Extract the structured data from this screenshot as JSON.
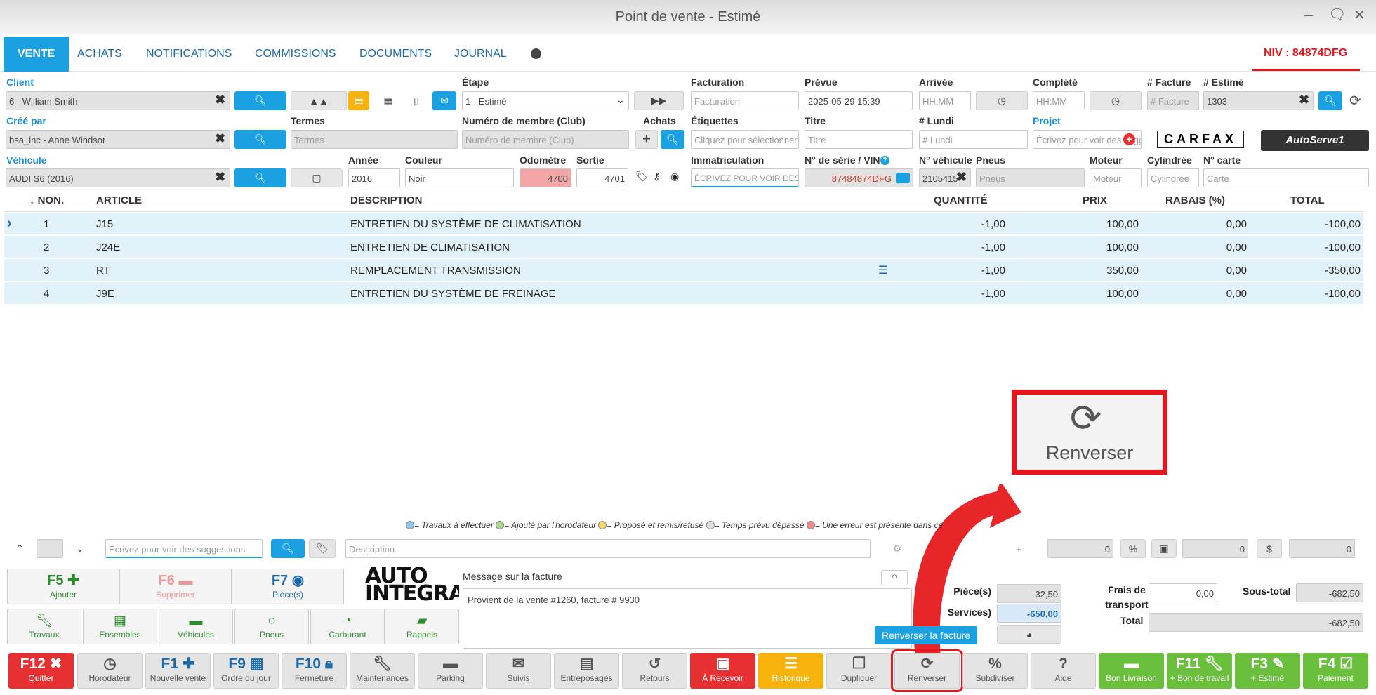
{
  "window": {
    "title": "Point de vente - Estimé",
    "min": "–",
    "chat": "🗨",
    "close": "✕"
  },
  "tabs": [
    "VENTE",
    "ACHATS",
    "NOTIFICATIONS",
    "COMMISSIONS",
    "DOCUMENTS",
    "JOURNAL"
  ],
  "niv": "NIV : 84874DFG",
  "form": {
    "client_label": "Client",
    "client_value": "6 - William Smith",
    "etape_label": "Étape",
    "etape_value": "1 - Estimé",
    "facturation_label": "Facturation",
    "facturation_ph": "Facturation",
    "prevue_label": "Prévue",
    "prevue_value": "2025-05-29 15:39",
    "arrivee_label": "Arrivée",
    "arrivee_ph": "HH:MM",
    "complete_label": "Complété",
    "complete_ph": "HH:MM",
    "nfacture_label": "# Facture",
    "nfacture_ph": "# Facture",
    "nestime_label": "# Estimé",
    "nestime_value": "1303",
    "cree_label": "Créé par",
    "cree_value": "bsa_inc - Anne Windsor",
    "termes_label": "Termes",
    "termes_ph": "Termes",
    "membre_label": "Numéro de membre (Club)",
    "membre_ph": "Numéro de membre (Club)",
    "achats_label": "Achats",
    "etiquettes_label": "Étiquettes",
    "etiquettes_ph": "Cliquez pour sélectionner",
    "titre_label": "Titre",
    "titre_ph": "Titre",
    "lundi_label": "# Lundi",
    "lundi_ph": "# Lundi",
    "projet_label": "Projet",
    "projet_ph": "Écrivez pour voir des suggestions",
    "carfax": "CARFAX",
    "autoserve": "AutoServe1",
    "vehicule_label": "Véhicule",
    "vehicule_value": "AUDI S6 (2016)",
    "annee_label": "Année",
    "annee_value": "2016",
    "couleur_label": "Couleur",
    "couleur_value": "Noir",
    "odometre_label": "Odomètre",
    "odometre_value": "4700",
    "sortie_label": "Sortie",
    "sortie_value": "4701",
    "immat_label": "Immatriculation",
    "immat_ph": "ÉCRIVEZ POUR VOIR DES SUGGESTIONS",
    "vin_label": "N° de série / VIN",
    "vin_value": "87484874DFG",
    "nveh_label": "N° véhicule",
    "nveh_value": "2105415",
    "pneus_label": "Pneus",
    "pneus_ph": "Pneus",
    "moteur_label": "Moteur",
    "moteur_ph": "Moteur",
    "cyl_label": "Cylindrée",
    "cyl_ph": "Cylindrée",
    "carte_label": "N° carte",
    "carte_ph": "Carte"
  },
  "table": {
    "headers": {
      "no": "↓ NON.",
      "article": "ARTICLE",
      "description": "DESCRIPTION",
      "quantite": "QUANTITÉ",
      "prix": "PRIX",
      "rabais": "RABAIS (%)",
      "total": "TOTAL"
    },
    "rows": [
      {
        "no": "1",
        "article": "J15",
        "description": "ENTRETIEN DU SYSTÈME DE CLIMATISATION",
        "quantite": "-1,00",
        "prix": "100,00",
        "rabais": "0,00",
        "total": "-100,00"
      },
      {
        "no": "2",
        "article": "J24E",
        "description": "ENTRETIEN DE CLIMATISATION",
        "quantite": "-1,00",
        "prix": "100,00",
        "rabais": "0,00",
        "total": "-100,00"
      },
      {
        "no": "3",
        "article": "RT",
        "description": "REMPLACEMENT TRANSMISSION",
        "quantite": "-1,00",
        "prix": "350,00",
        "rabais": "0,00",
        "total": "-350,00"
      },
      {
        "no": "4",
        "article": "J9E",
        "description": "ENTRETIEN DU SYSTÈME DE FREINAGE",
        "quantite": "-1,00",
        "prix": "100,00",
        "rabais": "0,00",
        "total": "-100,00"
      }
    ]
  },
  "callout": {
    "label": "Renverser"
  },
  "legend": [
    "= Travaux à effectuer",
    "= Ajouté par l'horodateur",
    "= Proposé et remis/refusé",
    "= Temps prévu dépassé",
    "= Une erreur est présente dans ce"
  ],
  "entry": {
    "search_ph": "Écrivez pour voir des suggestions",
    "desc_ph": "Description",
    "v1": "0",
    "v2": "0",
    "v3": "0",
    "pct": "%",
    "dollar": "$",
    "plus": "+"
  },
  "tiles": {
    "f5_key": "F5",
    "f5_label": "Ajouter",
    "f6_key": "F6",
    "f6_label": "Supprimer",
    "f7_key": "F7",
    "f7_label": "Pièce(s)",
    "logo_line1": "AUTO",
    "logo_line2": "INTEGRAT",
    "travaux": "Travaux",
    "ensembles": "Ensembles",
    "vehicules": "Véhicules",
    "pneus": "Pneus",
    "carburant": "Carburant",
    "rappels": "Rappels"
  },
  "message": {
    "label": "Message sur la facture",
    "text": "Provient de la vente #1260, facture # 9930"
  },
  "totals": {
    "pieces_label": "Pièce(s)",
    "pieces_value": "-32,50",
    "services_label": "Services)",
    "services_value": "-650,00",
    "frais_label": "Frais de transport",
    "frais_value": "0,00",
    "soustotal_label": "Sous-total",
    "soustotal_value": "-682,50",
    "total_label": "Total",
    "total_value": "-682,50"
  },
  "tooltip": "Renverser la facture",
  "fkeys": [
    {
      "key": "F12",
      "label": "Quitter"
    },
    {
      "key": "",
      "label": "Horodateur"
    },
    {
      "key": "F1",
      "label": "Nouvelle vente"
    },
    {
      "key": "F9",
      "label": "Ordre du jour"
    },
    {
      "key": "F10",
      "label": "Fermeture"
    },
    {
      "key": "",
      "label": "Maintenances"
    },
    {
      "key": "",
      "label": "Parking"
    },
    {
      "key": "",
      "label": "Suivis"
    },
    {
      "key": "",
      "label": "Entreposages"
    },
    {
      "key": "",
      "label": "Retours"
    },
    {
      "key": "",
      "label": "À Recevoir"
    },
    {
      "key": "",
      "label": "Historique"
    },
    {
      "key": "",
      "label": "Dupliquer"
    },
    {
      "key": "",
      "label": "Renverser"
    },
    {
      "key": "",
      "label": "Subdiviser"
    },
    {
      "key": "",
      "label": "Aide"
    },
    {
      "key": "",
      "label": "Bon Livraison"
    },
    {
      "key": "F11",
      "label": "+ Bon de travail"
    },
    {
      "key": "F3",
      "label": "+ Estimé"
    },
    {
      "key": "F4",
      "label": "Paiement"
    }
  ],
  "colors": {
    "accent": "#1ba1e2",
    "red": "#e63032",
    "orange": "#f7b20b",
    "green": "#6abf3c",
    "highlight": "#e8141c"
  }
}
